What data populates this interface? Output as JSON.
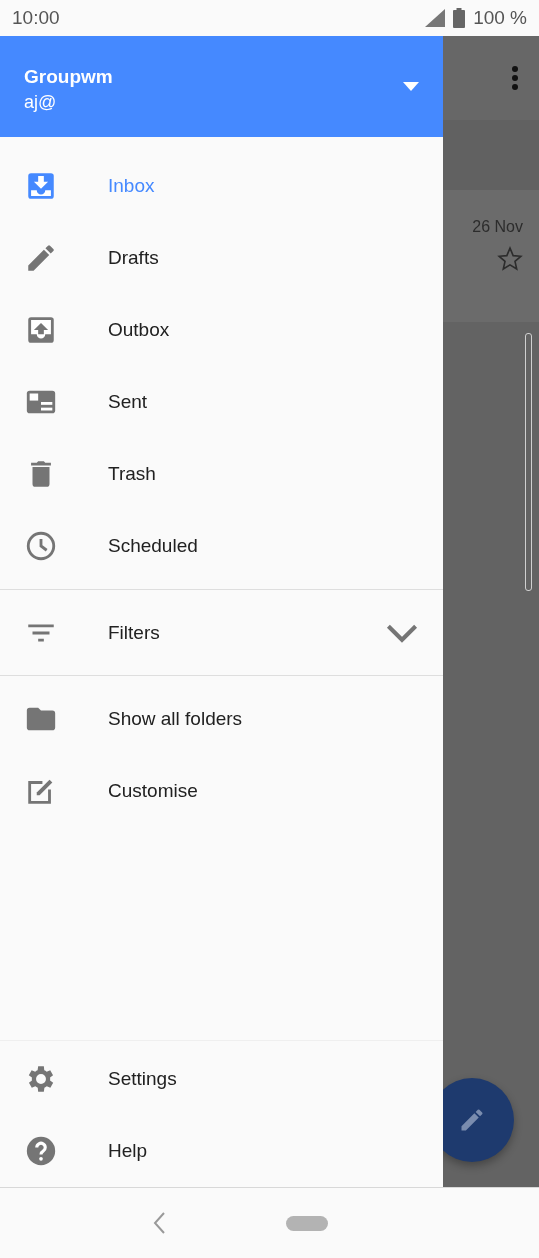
{
  "status_bar": {
    "time": "10:00",
    "battery": "100 %"
  },
  "background_app": {
    "message": {
      "date": "26 Nov",
      "starred": false
    }
  },
  "drawer": {
    "header": {
      "account": "Groupwm",
      "email": "aj@"
    },
    "folders": [
      {
        "kind": "inbox",
        "label": "Inbox",
        "selected": true
      },
      {
        "kind": "pencil",
        "label": "Drafts",
        "selected": false
      },
      {
        "kind": "outbox",
        "label": "Outbox",
        "selected": false
      },
      {
        "kind": "sent",
        "label": "Sent",
        "selected": false
      },
      {
        "kind": "trash",
        "label": "Trash",
        "selected": false
      },
      {
        "kind": "clock",
        "label": "Scheduled",
        "selected": false
      }
    ],
    "filters": {
      "label": "Filters",
      "expanded": false
    },
    "extras": [
      {
        "kind": "folder",
        "label": "Show all folders"
      },
      {
        "kind": "edit",
        "label": "Customise"
      }
    ],
    "footer": [
      {
        "kind": "gear",
        "label": "Settings"
      },
      {
        "kind": "help",
        "label": "Help"
      }
    ]
  }
}
